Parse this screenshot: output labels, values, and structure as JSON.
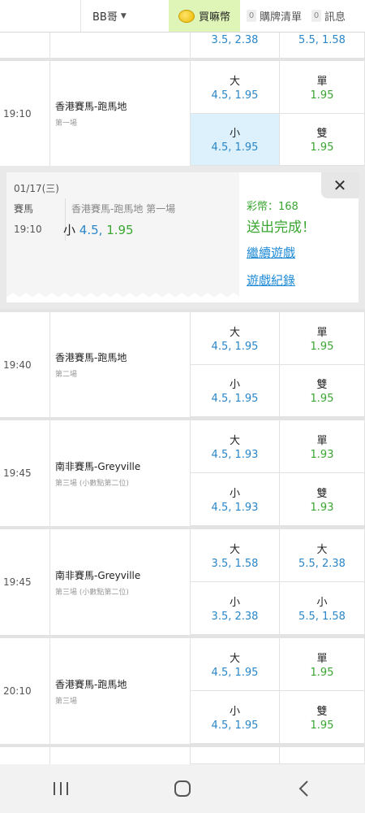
{
  "header": {
    "user": "BB哥",
    "buy_label": "買嘛幣",
    "cart_count": "0",
    "cart_label": "購牌清單",
    "msg_count": "0",
    "msg_label": "訊息"
  },
  "top_partial": {
    "a": "3.5, 2.38",
    "b": "5.5, 1.58"
  },
  "races": [
    {
      "time": "19:10",
      "venue": "香港賽馬-跑馬地",
      "sub": "第一場",
      "cells": [
        {
          "label": "大",
          "value": "4.5, 1.95",
          "color": "blue"
        },
        {
          "label": "單",
          "value": "1.95",
          "color": "green"
        },
        {
          "label": "小",
          "value": "4.5, 1.95",
          "color": "blue",
          "selected": true
        },
        {
          "label": "雙",
          "value": "1.95",
          "color": "green"
        }
      ]
    },
    {
      "time": "19:40",
      "venue": "香港賽馬-跑馬地",
      "sub": "第二場",
      "cells": [
        {
          "label": "大",
          "value": "4.5, 1.95",
          "color": "blue"
        },
        {
          "label": "單",
          "value": "1.95",
          "color": "green"
        },
        {
          "label": "小",
          "value": "4.5, 1.95",
          "color": "blue"
        },
        {
          "label": "雙",
          "value": "1.95",
          "color": "green"
        }
      ]
    },
    {
      "time": "19:45",
      "venue": "南非賽馬-Greyville",
      "sub": "第三場 (小數點第二位)",
      "cells": [
        {
          "label": "大",
          "value": "4.5, 1.93",
          "color": "blue"
        },
        {
          "label": "單",
          "value": "1.93",
          "color": "green"
        },
        {
          "label": "小",
          "value": "4.5, 1.93",
          "color": "blue"
        },
        {
          "label": "雙",
          "value": "1.93",
          "color": "green"
        }
      ]
    },
    {
      "time": "19:45",
      "venue": "南非賽馬-Greyville",
      "sub": "第三場 (小數點第二位)",
      "cells": [
        {
          "label": "大",
          "value": "3.5, 1.58",
          "color": "blue"
        },
        {
          "label": "大",
          "value": "5.5, 2.38",
          "color": "blue"
        },
        {
          "label": "小",
          "value": "3.5, 2.38",
          "color": "blue"
        },
        {
          "label": "小",
          "value": "5.5, 1.58",
          "color": "blue"
        }
      ]
    },
    {
      "time": "20:10",
      "venue": "香港賽馬-跑馬地",
      "sub": "第三場",
      "cells": [
        {
          "label": "大",
          "value": "4.5, 1.95",
          "color": "blue"
        },
        {
          "label": "單",
          "value": "1.95",
          "color": "green"
        },
        {
          "label": "小",
          "value": "4.5, 1.95",
          "color": "blue"
        },
        {
          "label": "雙",
          "value": "1.95",
          "color": "green"
        }
      ]
    }
  ],
  "confirm": {
    "date": "01/17(三)",
    "sport": "賽馬",
    "race": "香港賽馬-跑馬地 第一場",
    "time": "19:10",
    "bet_label": "小",
    "bet_line": "4.5,",
    "bet_odds": "1.95",
    "credit": "彩幣：168",
    "done": "送出完成！",
    "continue": "繼續遊戲",
    "history": "遊戲紀錄"
  },
  "colors": {
    "blue": "#2a86c8",
    "green": "#3aa631",
    "selected": "#dcf1fb",
    "buy_bg": "#dff5b8"
  }
}
